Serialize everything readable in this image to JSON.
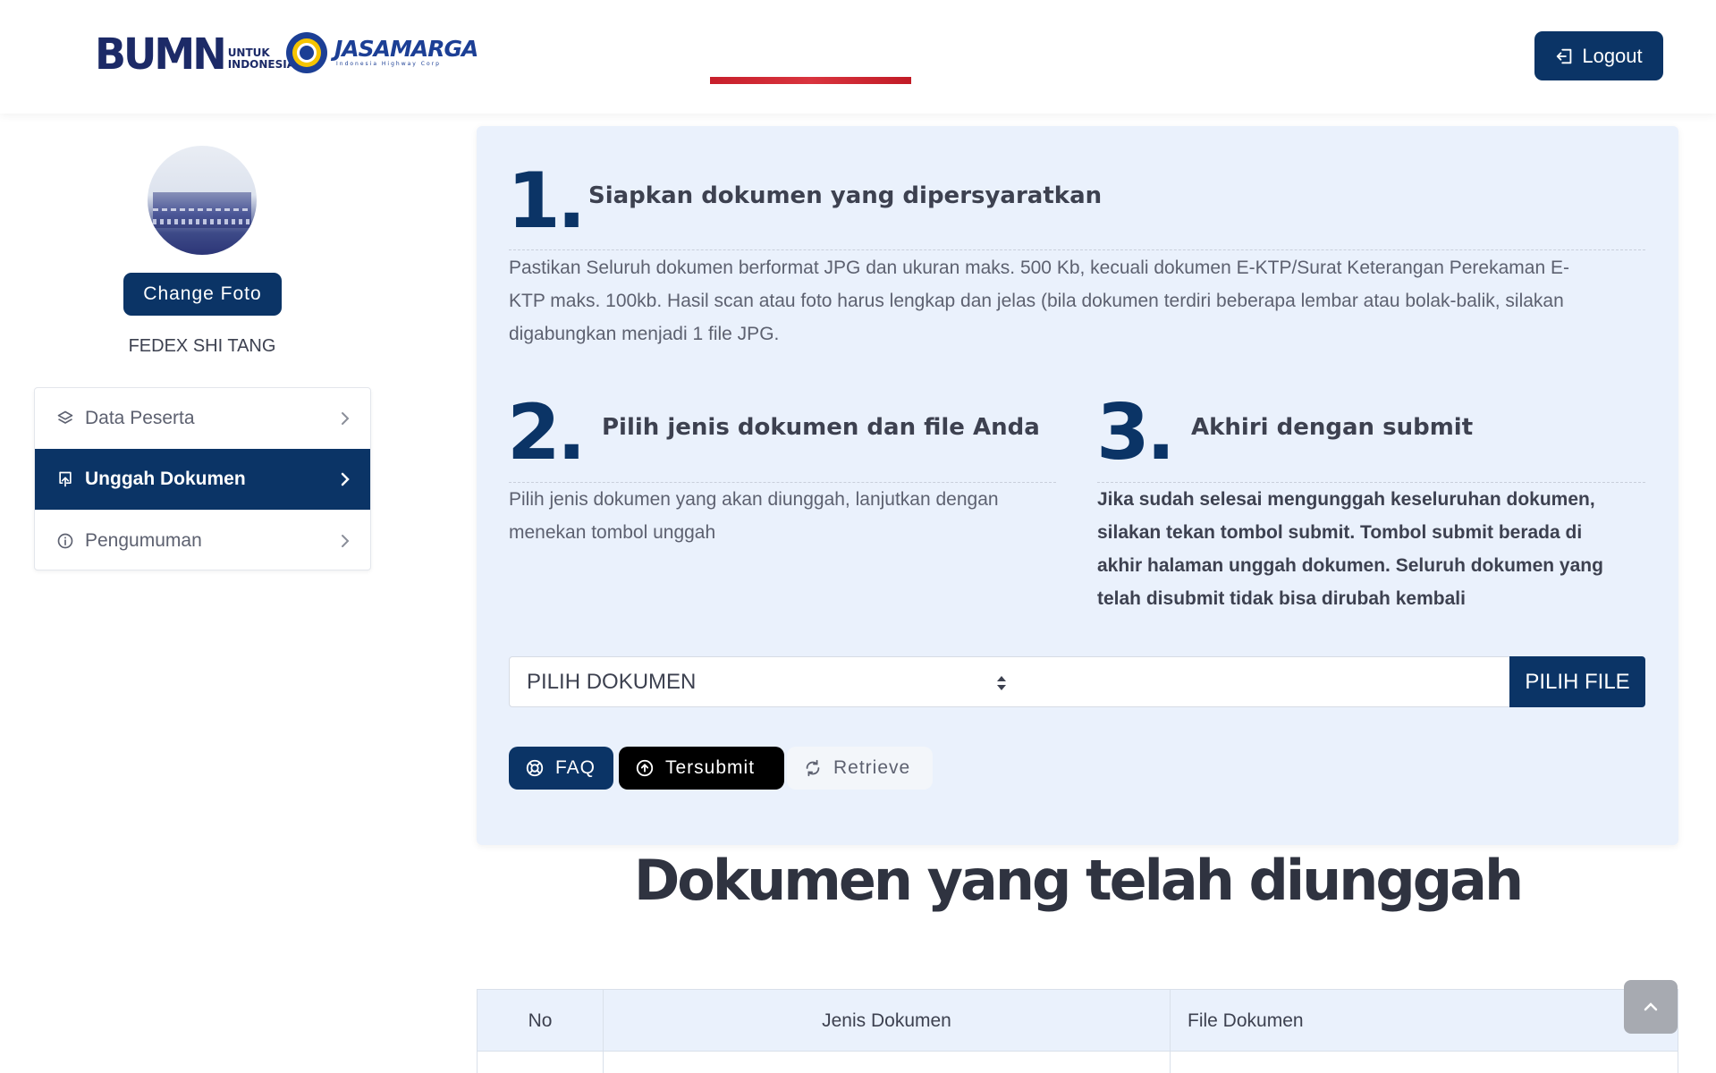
{
  "header": {
    "logo_bumn": {
      "main": "BUMN",
      "sub_line1": "UNTUK",
      "sub_line2": "INDONESIA"
    },
    "logo_jasamarga": {
      "main": "JASAMARGA",
      "tagline": "Indonesia Highway Corp"
    },
    "logout_label": "Logout"
  },
  "profile": {
    "change_photo_label": "Change Foto",
    "name": "FEDEX SHI TANG"
  },
  "sidebar": {
    "items": [
      {
        "label": "Data Peserta",
        "icon": "layers-icon",
        "active": false
      },
      {
        "label": "Unggah Dokumen",
        "icon": "upload-icon",
        "active": true
      },
      {
        "label": "Pengumuman",
        "icon": "info-icon",
        "active": false
      }
    ]
  },
  "steps": [
    {
      "number": "1.",
      "title": "Siapkan dokumen yang dipersyaratkan",
      "text_lines": [
        "Pastikan Seluruh dokumen berformat JPG dan ukuran maks. 500 Kb, kecuali dokumen E-KTP/Surat Keterangan Perekaman E-",
        "KTP maks. 100kb. Hasil scan atau foto harus lengkap dan jelas (bila dokumen terdiri beberapa lembar atau bolak-balik, silakan",
        "digabungkan menjadi 1 file JPG."
      ]
    },
    {
      "number": "2.",
      "title": "Pilih jenis dokumen dan file Anda",
      "text_lines": [
        "Pilih jenis dokumen yang akan diunggah, lanjutkan dengan",
        "menekan tombol unggah"
      ]
    },
    {
      "number": "3.",
      "title": "Akhiri dengan submit",
      "text_lines": [
        "Jika sudah selesai mengunggah keseluruhan dokumen,",
        "silakan tekan tombol submit. Tombol submit berada di",
        "akhir halaman unggah dokumen. Seluruh dokumen yang",
        "telah disubmit tidak bisa dirubah kembali"
      ]
    }
  ],
  "upload": {
    "select_value": "PILIH DOKUMEN",
    "file_value": "",
    "choose_file_label": "PILIH FILE"
  },
  "actions": {
    "faq_label": "FAQ",
    "submitted_label": "Tersubmit",
    "retrieve_label": "Retrieve"
  },
  "documents": {
    "heading": "Dokumen yang telah diunggah",
    "columns": [
      "No",
      "Jenis Dokumen",
      "File Dokumen"
    ]
  },
  "colors": {
    "primary": "#0b3466",
    "panel_bg": "#eaf1fc",
    "text": "#3d4150",
    "muted_text": "#5d6170"
  }
}
